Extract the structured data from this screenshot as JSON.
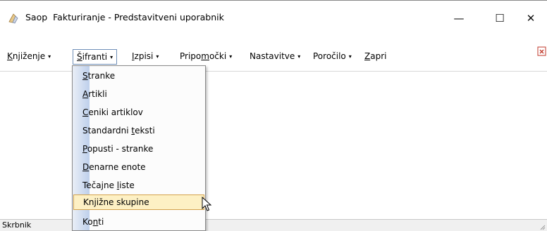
{
  "window": {
    "title": "Saop  Fakturiranje - Predstavitveni uporabnik",
    "minimize_glyph": "—",
    "maximize_glyph": "☐",
    "close_glyph": "✕",
    "icon": "app-icon"
  },
  "menubar": {
    "items": [
      {
        "pre": "",
        "u": "K",
        "post": "njiženje",
        "arrow": "▾"
      },
      {
        "pre": "",
        "u": "Š",
        "post": "ifranti",
        "arrow": "▾"
      },
      {
        "pre": "",
        "u": "I",
        "post": "zpisi",
        "arrow": "▾"
      },
      {
        "pre": "Pripo",
        "u": "m",
        "post": "očki",
        "arrow": "▾"
      },
      {
        "pre": "Nastavitve",
        "u": "",
        "post": "",
        "arrow": "▾"
      },
      {
        "pre": "Poročilo",
        "u": "",
        "post": "",
        "arrow": "▾"
      },
      {
        "pre": "",
        "u": "Z",
        "post": "apri",
        "arrow": ""
      }
    ]
  },
  "dropdown": {
    "items": [
      {
        "pre": "",
        "u": "S",
        "post": "tranke"
      },
      {
        "pre": "",
        "u": "A",
        "post": "rtikli"
      },
      {
        "pre": "",
        "u": "C",
        "post": "eniki artiklov"
      },
      {
        "pre": "Standardni ",
        "u": "t",
        "post": "eksti"
      },
      {
        "pre": "",
        "u": "P",
        "post": "opusti - stranke"
      },
      {
        "pre": "",
        "u": "D",
        "post": "enarne enote"
      },
      {
        "pre": "Tečajne ",
        "u": "l",
        "post": "iste"
      },
      {
        "pre": "Knjižne skupine",
        "u": "",
        "post": ""
      },
      {
        "pre": "Ko",
        "u": "n",
        "post": "ti"
      }
    ],
    "hover_index": 7
  },
  "statusbar": {
    "text": "Skrbnik"
  },
  "colors": {
    "hover_bg": "#fdf0c4",
    "hover_border": "#d4a24a",
    "gutter_start": "#e9eef6",
    "gutter_end": "#bed0ec",
    "active_menu_border": "#6f8fb8"
  }
}
